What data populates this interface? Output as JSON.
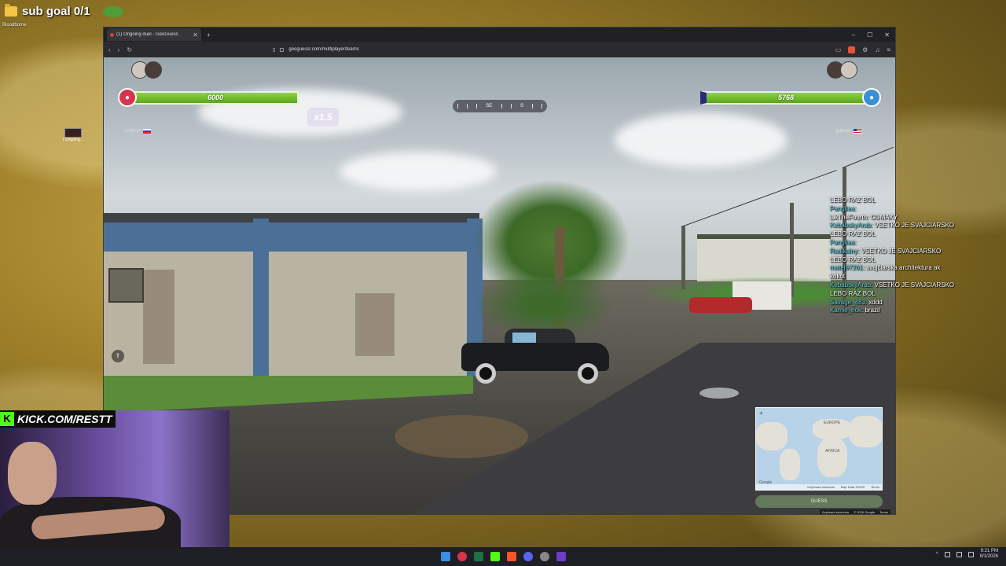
{
  "desktop": {
    "sub_goal": "sub goal 0/1",
    "folder_label": "Bloodborne",
    "shortcut_label": "ł Ongoing..."
  },
  "browser": {
    "tab_title": "(1) Ongoing duel - GeoGuess",
    "url": "geoguessr.com/multiplayer/teams",
    "window_controls": [
      "–",
      "☐",
      "✕"
    ]
  },
  "game": {
    "left_team": {
      "score": "6000",
      "names": "resl/rod"
    },
    "right_team": {
      "score": "5768",
      "names": "lpb/red"
    },
    "multiplier": "x1.5",
    "compass": {
      "left": "SE",
      "right": "S"
    },
    "minimap": {
      "label_africa": "AFRICA",
      "label_europe": "EUROPE",
      "google": "Google",
      "footer": [
        "Keyboard shortcuts",
        "Map Data ©2025",
        "Terms"
      ]
    },
    "guess_button": "GUESS",
    "attribution": [
      "Keyboard shortcuts",
      "© 2026 Google",
      "Terms"
    ]
  },
  "chat": [
    {
      "user": "",
      "msg": "LEBO RAZ BOL"
    },
    {
      "user": "Pangliaa:",
      "msg": ""
    },
    {
      "user": "",
      "msg": "LikTheFourth: GUMAKY"
    },
    {
      "user": "KebabskyArab:",
      "msg": "VSETKO JE SVAJCIARSKO"
    },
    {
      "user": "",
      "msg": "LEBO RAZ BOL"
    },
    {
      "user": "Pangliaa:",
      "msg": ""
    },
    {
      "user": "Radikalny:",
      "msg": "VSETKO JE SVAJCIARSKO"
    },
    {
      "user": "",
      "msg": "LEBO RAZ BOL"
    },
    {
      "user": "matej97261:",
      "msg": "svajčiarska architektura ak"
    },
    {
      "user": "",
      "msg": "kokot"
    },
    {
      "user": "KebabskyArab:",
      "msg": "VSETKO JE SVAJCIARSKO"
    },
    {
      "user": "",
      "msg": "LEBO RAZ BOL"
    },
    {
      "user": "Savage_483:",
      "msg": "xddd"
    },
    {
      "user": "Kamie_nok:",
      "msg": "brazil"
    }
  ],
  "webcam": {
    "banner": "KICK.COM/RESTT"
  },
  "taskbar": {
    "time": "9:21 PM",
    "date": "8/1/2026"
  },
  "colors": {
    "hud_green": "#6fbf2a",
    "pin_red": "#d8344e",
    "pin_blue": "#3a8fd8",
    "kick_green": "#53fc18"
  }
}
